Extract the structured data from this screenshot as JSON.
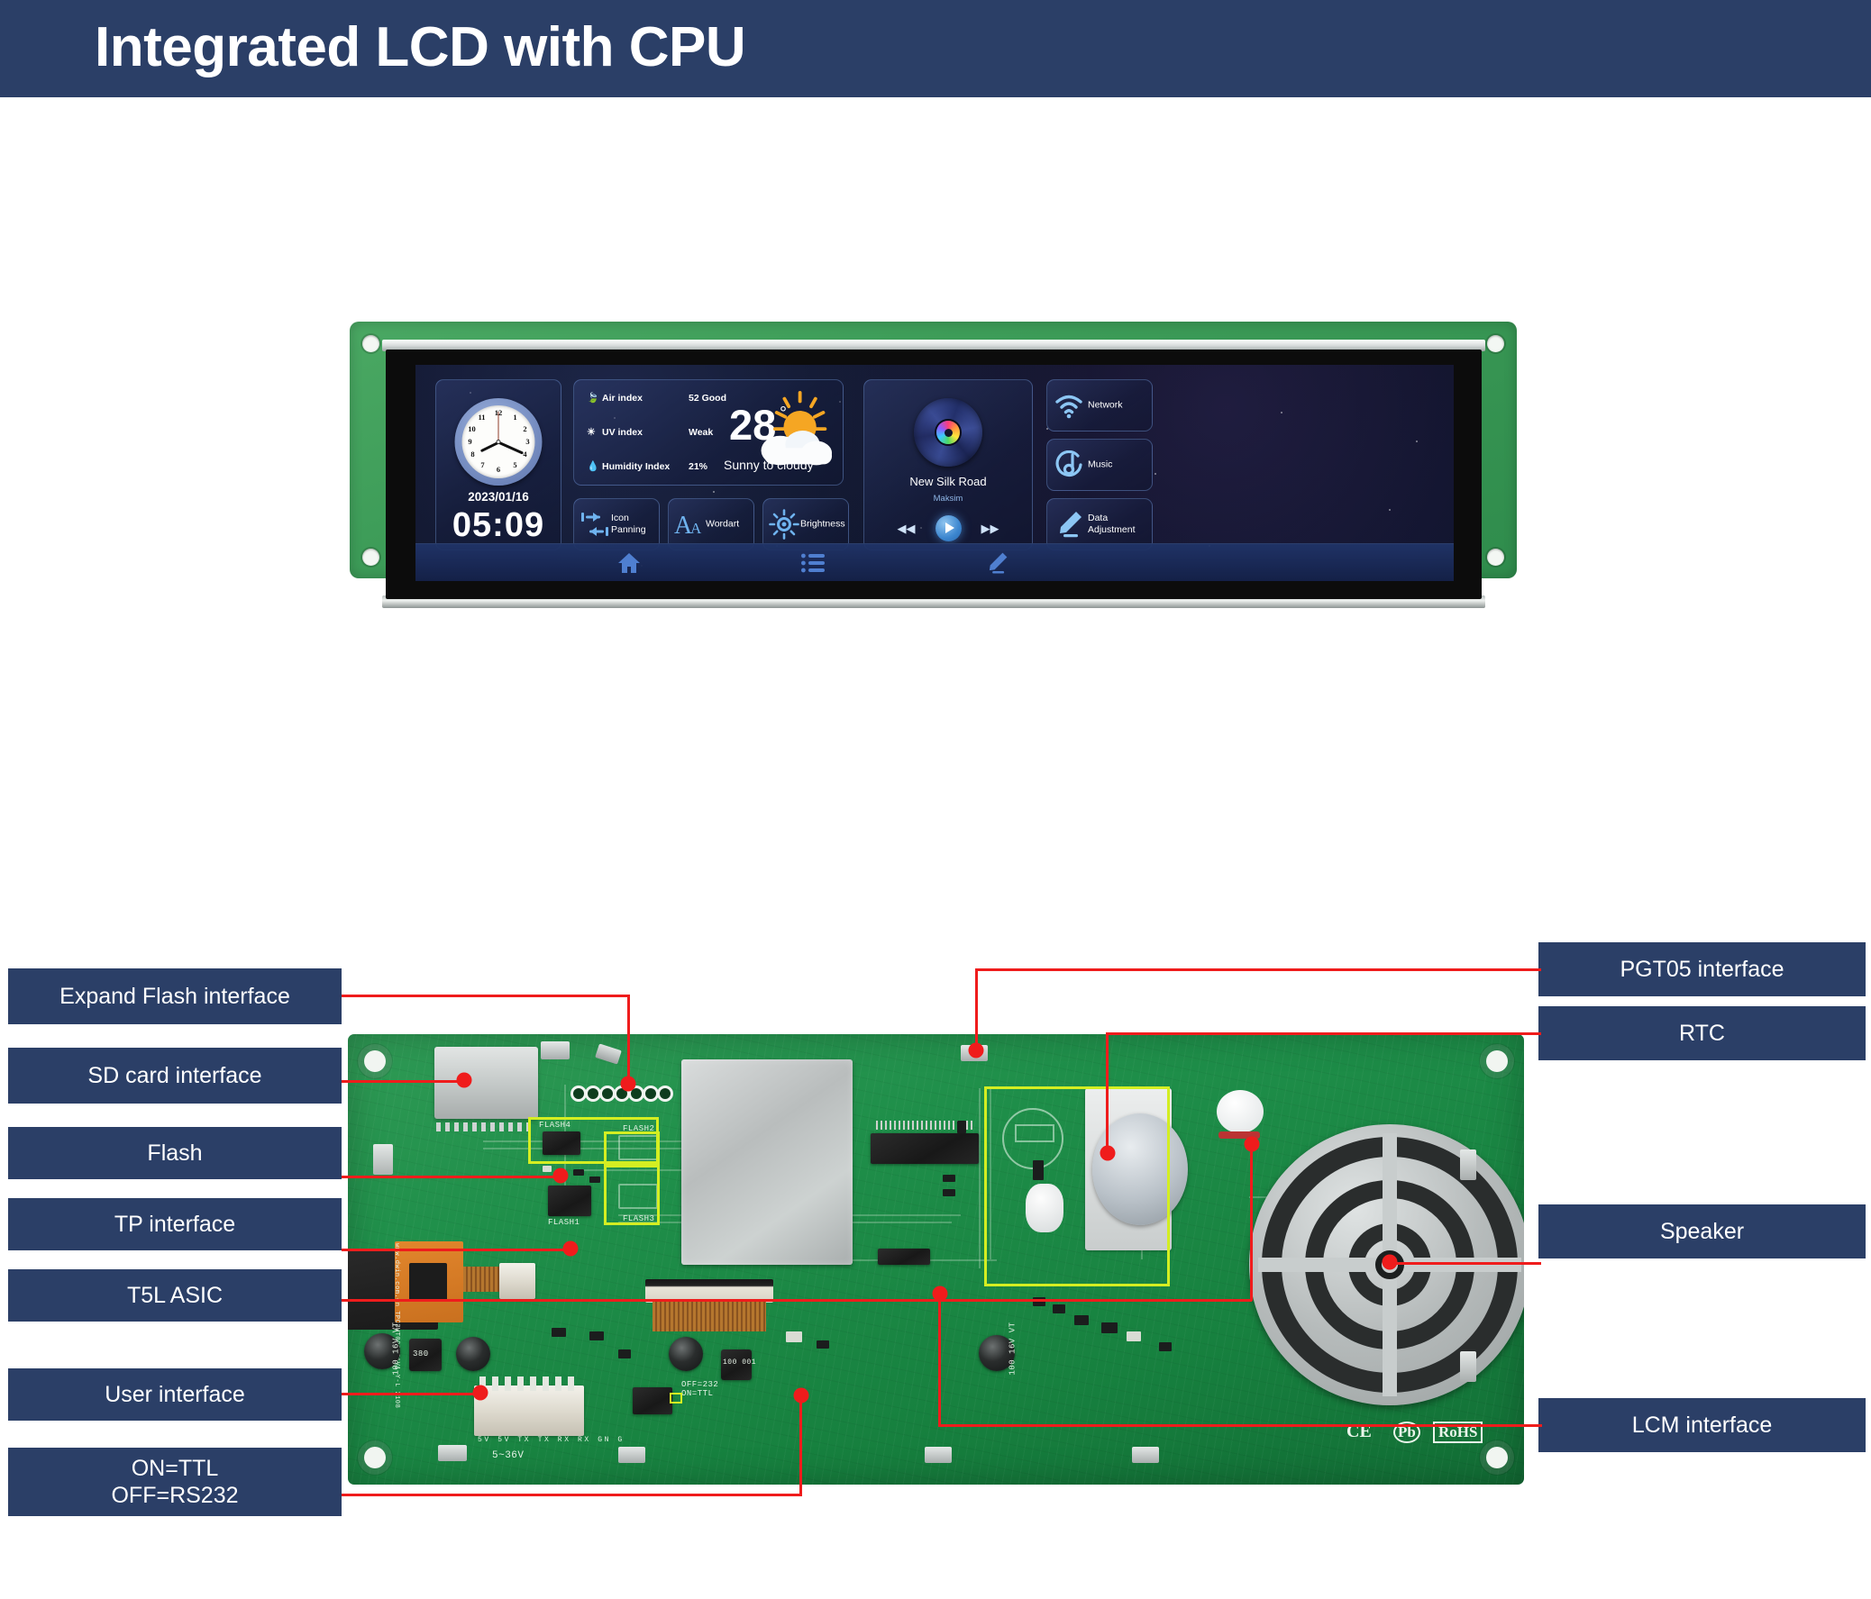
{
  "header": {
    "title": "Integrated LCD with CPU",
    "band_color": "#2b3f67"
  },
  "lcd_screen": {
    "clock": {
      "date": "2023/01/16",
      "time": "05:09",
      "numerals": [
        "12",
        "1",
        "2",
        "3",
        "4",
        "5",
        "6",
        "7",
        "8",
        "9",
        "10",
        "11"
      ],
      "hour_hand_deg": 244,
      "minute_hand_deg": 114,
      "second_hand_deg": 0
    },
    "weather": {
      "rows": [
        {
          "icon": "leaf-icon",
          "label": "Air index",
          "value": "52 Good"
        },
        {
          "icon": "sun-icon",
          "label": "UV index",
          "value": "Weak"
        },
        {
          "icon": "water-drop-icon",
          "label": "Humidity Index",
          "value": "21%"
        }
      ],
      "temperature": "28",
      "degree_symbol": "°",
      "description": "Sunny to cloudy",
      "condition_icon": "sun-behind-cloud-icon"
    },
    "action_buttons": [
      {
        "icon": "icon-panning-icon",
        "label": "Icon\nPanning",
        "label_line1": "Icon",
        "label_line2": "Panning"
      },
      {
        "icon": "wordart-icon",
        "label": "Wordart",
        "label_line1": "Wordart",
        "label_line2": ""
      },
      {
        "icon": "brightness-icon",
        "label": "Brightness",
        "label_line1": "Brightness",
        "label_line2": ""
      }
    ],
    "music": {
      "title": "New Silk Road",
      "artist": "Maksim",
      "disc_icon": "cd-disc-icon",
      "prev_icon": "rewind-icon",
      "play_icon": "play-icon",
      "next_icon": "fast-forward-icon"
    },
    "side_buttons": [
      {
        "icon": "wifi-icon",
        "label_line1": "Network",
        "label_line2": ""
      },
      {
        "icon": "music-note-icon",
        "label_line1": "Music",
        "label_line2": ""
      },
      {
        "icon": "pencil-icon",
        "label_line1": "Data",
        "label_line2": "Adjustment"
      }
    ],
    "nav_bar": [
      {
        "icon": "home-icon"
      },
      {
        "icon": "list-icon"
      },
      {
        "icon": "pencil-icon"
      }
    ]
  },
  "pcb_labels": {
    "left": [
      {
        "text": "Expand Flash interface",
        "lines": [
          "Expand Flash interface"
        ]
      },
      {
        "text": "SD card interface",
        "lines": [
          "SD card interface"
        ]
      },
      {
        "text": "Flash",
        "lines": [
          "Flash"
        ]
      },
      {
        "text": "TP interface",
        "lines": [
          "TP interface"
        ]
      },
      {
        "text": "T5L ASIC",
        "lines": [
          "T5L ASIC"
        ]
      },
      {
        "text": "User interface",
        "lines": [
          "User interface"
        ]
      },
      {
        "text": "ON=TTL OFF=RS232",
        "lines": [
          "ON=TTL",
          "OFF=RS232"
        ]
      }
    ],
    "right": [
      {
        "text": "PGT05 interface",
        "lines": [
          "PGT05 interface"
        ]
      },
      {
        "text": "RTC",
        "lines": [
          "RTC"
        ]
      },
      {
        "text": "Speaker",
        "lines": [
          "Speaker"
        ]
      },
      {
        "text": "LCM interface",
        "lines": [
          "LCM interface"
        ]
      }
    ]
  },
  "pcb_silkscreen": {
    "flash1": "FLASH1",
    "flash2": "FLASH2",
    "flash3": "FLASH3",
    "flash4": "FLASH4",
    "t5l_asic": "T5L ASIC",
    "voltage_range": "5~36V",
    "jumper_note_line1": "OFF=232",
    "jumper_note_line2": "ON=TTL",
    "pin_labels": "5V 5V TX TX RX RX GN G",
    "cap_1": "100 16V VT",
    "cap_2": "100 16V VT",
    "cap_3": "100 16V VT",
    "inductor_1": "380",
    "inductor_2": "100 001",
    "tp_module_text": "www.dwin.com.cn  TPC3WT001H01V1  Y-L 2108",
    "cert_ce": "CE",
    "cert_pb": "Pb",
    "cert_rohs": "RoHS"
  },
  "colors": {
    "banner": "#2b3f67",
    "label_box": "#2b3f67",
    "leader_line": "#ef1c1c",
    "highlight_box": "#d4ee22",
    "pcb_green": "#1f8f4a",
    "accent_blue": "#6fa8e8"
  }
}
